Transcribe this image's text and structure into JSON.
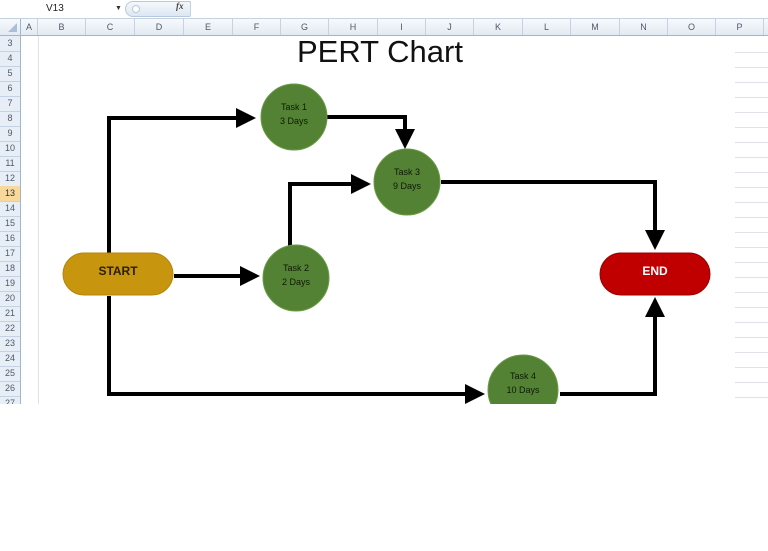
{
  "formula_bar": {
    "name_box": "V13",
    "fx_label": "fx",
    "formula": ""
  },
  "columns": [
    "A",
    "B",
    "C",
    "D",
    "E",
    "F",
    "G",
    "H",
    "I",
    "J",
    "K",
    "L",
    "M",
    "N",
    "O",
    "P"
  ],
  "rows": [
    "3",
    "4",
    "5",
    "6",
    "7",
    "8",
    "9",
    "10",
    "11",
    "12",
    "13",
    "14",
    "15",
    "16",
    "17",
    "18",
    "19",
    "20",
    "21",
    "22",
    "23",
    "24",
    "25",
    "26",
    "27"
  ],
  "selected_row": "13",
  "chart": {
    "title": "PERT Chart",
    "colors": {
      "start": "#c7950e",
      "end": "#c00000",
      "task": "#548235",
      "arrow": "#000000"
    },
    "start": {
      "label": "START"
    },
    "end": {
      "label": "END"
    },
    "tasks": [
      {
        "name": "Task 1",
        "duration": "3 Days"
      },
      {
        "name": "Task 2",
        "duration": "2 Days"
      },
      {
        "name": "Task 3",
        "duration": "9 Days"
      },
      {
        "name": "Task 4",
        "duration": "10 Days"
      }
    ],
    "edges": [
      [
        "START",
        "Task 1"
      ],
      [
        "START",
        "Task 2"
      ],
      [
        "START",
        "Task 4"
      ],
      [
        "Task 1",
        "Task 3"
      ],
      [
        "Task 2",
        "Task 3"
      ],
      [
        "Task 3",
        "END"
      ],
      [
        "Task 4",
        "END"
      ]
    ]
  }
}
